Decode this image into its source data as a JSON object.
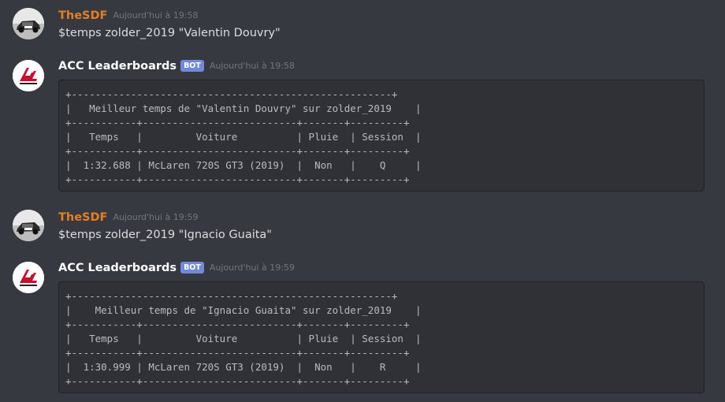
{
  "messages": [
    {
      "author": "TheSDF",
      "timestamp": "Aujourd'hui à 19:58",
      "text": "$temps zolder_2019 \"Valentin Douvry\"",
      "avatar_icon": "car-photo-avatar"
    },
    {
      "author": "ACC Leaderboards",
      "bot_tag": "BOT",
      "timestamp": "Aujourd'hui à 19:58",
      "avatar_icon": "assetto-corsa-logo",
      "code": "+------------------------------------------------------+\n|   Meilleur temps de \"Valentin Douvry\" sur zolder_2019    |\n+-----------+--------------------------+-------+---------+\n|   Temps   |         Voiture          | Pluie  | Session  |\n+-----------+--------------------------+-------+---------+\n|  1:32.688 | McLaren 720S GT3 (2019)  |  Non   |    Q     |\n+-----------+--------------------------+-------+---------+"
    },
    {
      "author": "TheSDF",
      "timestamp": "Aujourd'hui à 19:59",
      "text": "$temps zolder_2019 \"Ignacio Guaita\"",
      "avatar_icon": "car-photo-avatar"
    },
    {
      "author": "ACC Leaderboards",
      "bot_tag": "BOT",
      "timestamp": "Aujourd'hui à 19:59",
      "avatar_icon": "assetto-corsa-logo",
      "code": "+------------------------------------------------------+\n|    Meilleur temps de \"Ignacio Guaita\" sur zolder_2019    |\n+-----------+--------------------------+-------+---------+\n|   Temps   |         Voiture          | Pluie  | Session  |\n+-----------+--------------------------+-------+---------+\n|  1:30.999 | McLaren 720S GT3 (2019)  |  Non   |    R     |\n+-----------+--------------------------+-------+---------+"
    }
  ],
  "colors": {
    "background": "#36393f",
    "code_background": "#2f3136",
    "user_color": "#e67e22",
    "bot_tag": "#7289da",
    "timestamp": "#72767d",
    "text": "#dcddde"
  }
}
